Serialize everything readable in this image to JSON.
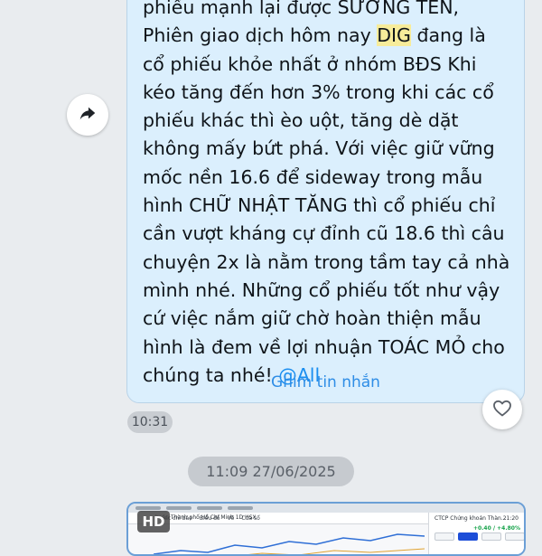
{
  "message": {
    "line_1": "phiếu mạnh lại được SƯỚNG TÊN,",
    "line_2_pre": "Phiên giao dịch hôm nay ",
    "ticker": "DIG",
    "line_2_post": " đang là",
    "body": "cổ phiếu khỏe nhất ở nhóm BĐS Khi\nkéo tăng đến hơn 3% trong khi các cổ\nphiếu khác thì èo uột, tăng dè dặt\nkhông mấy bứt phá. Với việc giữ vững\nmốc nền 16.6 để sideway trong mẫu\nhình CHỮ NHẬT TĂNG thì cổ phiếu chỉ\ncần vượt kháng cự đỉnh cũ 18.6 thì câu\nchuyện 2x là nằm trong tầm tay cả nhà\nmình nhé. Những cổ phiếu tốt như vậy\ncứ việc nắm giữ chờ hoàn thiện mẫu\nhình là đem về lợi nhuận TOÁC MỎ cho\nchúng ta nhé! ",
    "mention": "@All",
    "pin_label": "Ghim tin nhắn",
    "time": "10:31"
  },
  "date_separator": "11:09 27/06/2025",
  "image_message": {
    "hd_badge": "HD",
    "caption": "hoán Thành phố Hồ Chí Minh  1D  HSX",
    "toolbar": [
      "Các chỉ báo",
      "Biểu đồ",
      "Vẽ",
      "Cửa sổ"
    ],
    "side_title": "CTCP Chứng khoán Thàn...",
    "side_time": "21:20",
    "side_change": "+0.40 / +4.80%"
  },
  "icons": {
    "share": "share-arrow-icon",
    "react": "heart-icon"
  },
  "colors": {
    "bubble": "#dbeffd",
    "link": "#2e8de6",
    "highlight": "#f7ec9a",
    "background": "#e9ecef"
  }
}
